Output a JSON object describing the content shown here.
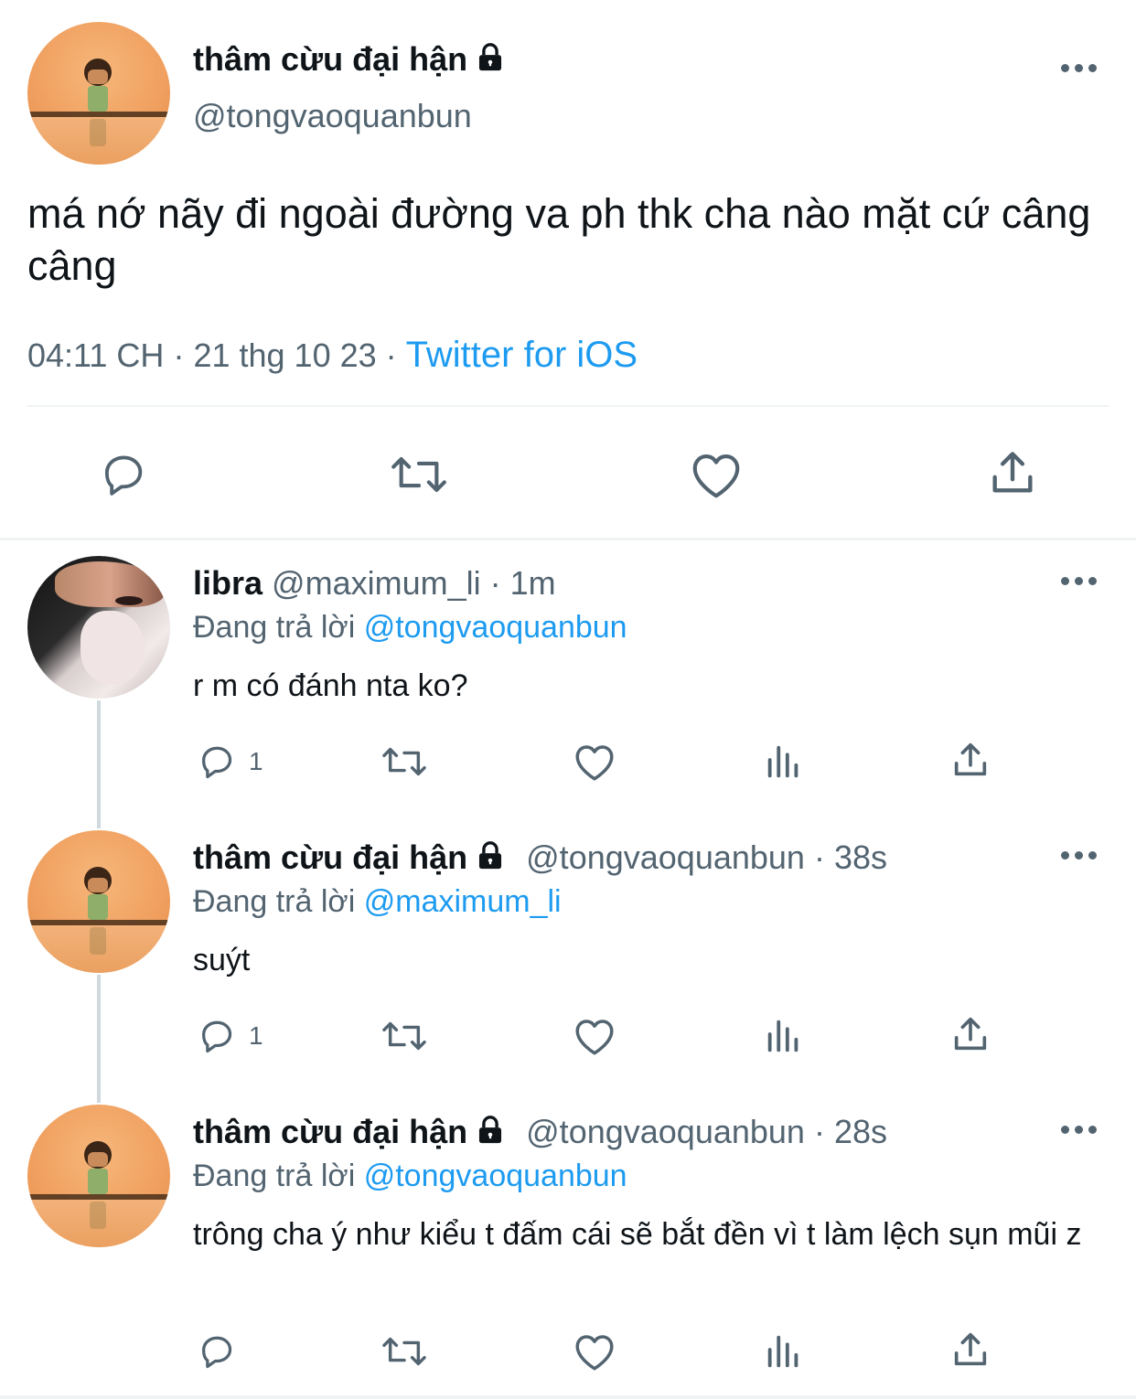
{
  "main_tweet": {
    "display_name": "thâm cừu đại hận",
    "handle": "@tongvaoquanbun",
    "text": "má nớ nãy đi ngoài đường va ph thk cha nào mặt cứ câng câng",
    "time": "04:11 CH",
    "dot1": "·",
    "date": "21 thg 10 23",
    "dot2": "·",
    "source": "Twitter for iOS",
    "icons": [
      "reply-icon",
      "retweet-icon",
      "like-icon",
      "share-icon"
    ]
  },
  "replies": [
    {
      "display_name": "libra",
      "handle": "@maximum_li",
      "dot": "·",
      "time": "1m",
      "replying_prefix": "Đang trả lời",
      "replying_to": "@tongvaoquanbun",
      "text": "r m có đánh nta ko?",
      "reply_count": "1",
      "locked": false
    },
    {
      "display_name": "thâm cừu đại hận",
      "handle": "@tongvaoquanbun",
      "dot": "·",
      "time": "38s",
      "replying_prefix": "Đang trả lời",
      "replying_to": "@maximum_li",
      "text": "suýt",
      "reply_count": "1",
      "locked": true
    },
    {
      "display_name": "thâm cừu đại hận",
      "handle": "@tongvaoquanbun",
      "dot": "·",
      "time": "28s",
      "replying_prefix": "Đang trả lời",
      "replying_to": "@tongvaoquanbun",
      "text": "trông cha ý như kiểu t đấm cái sẽ bắt đền vì t làm lệch sụn mũi z",
      "reply_count": "",
      "locked": true
    }
  ],
  "colors": {
    "text": "#0f1419",
    "secondary": "#536471",
    "link": "#1d9bf0",
    "divider": "#eff3f4",
    "thread_line": "#cfd9de"
  }
}
